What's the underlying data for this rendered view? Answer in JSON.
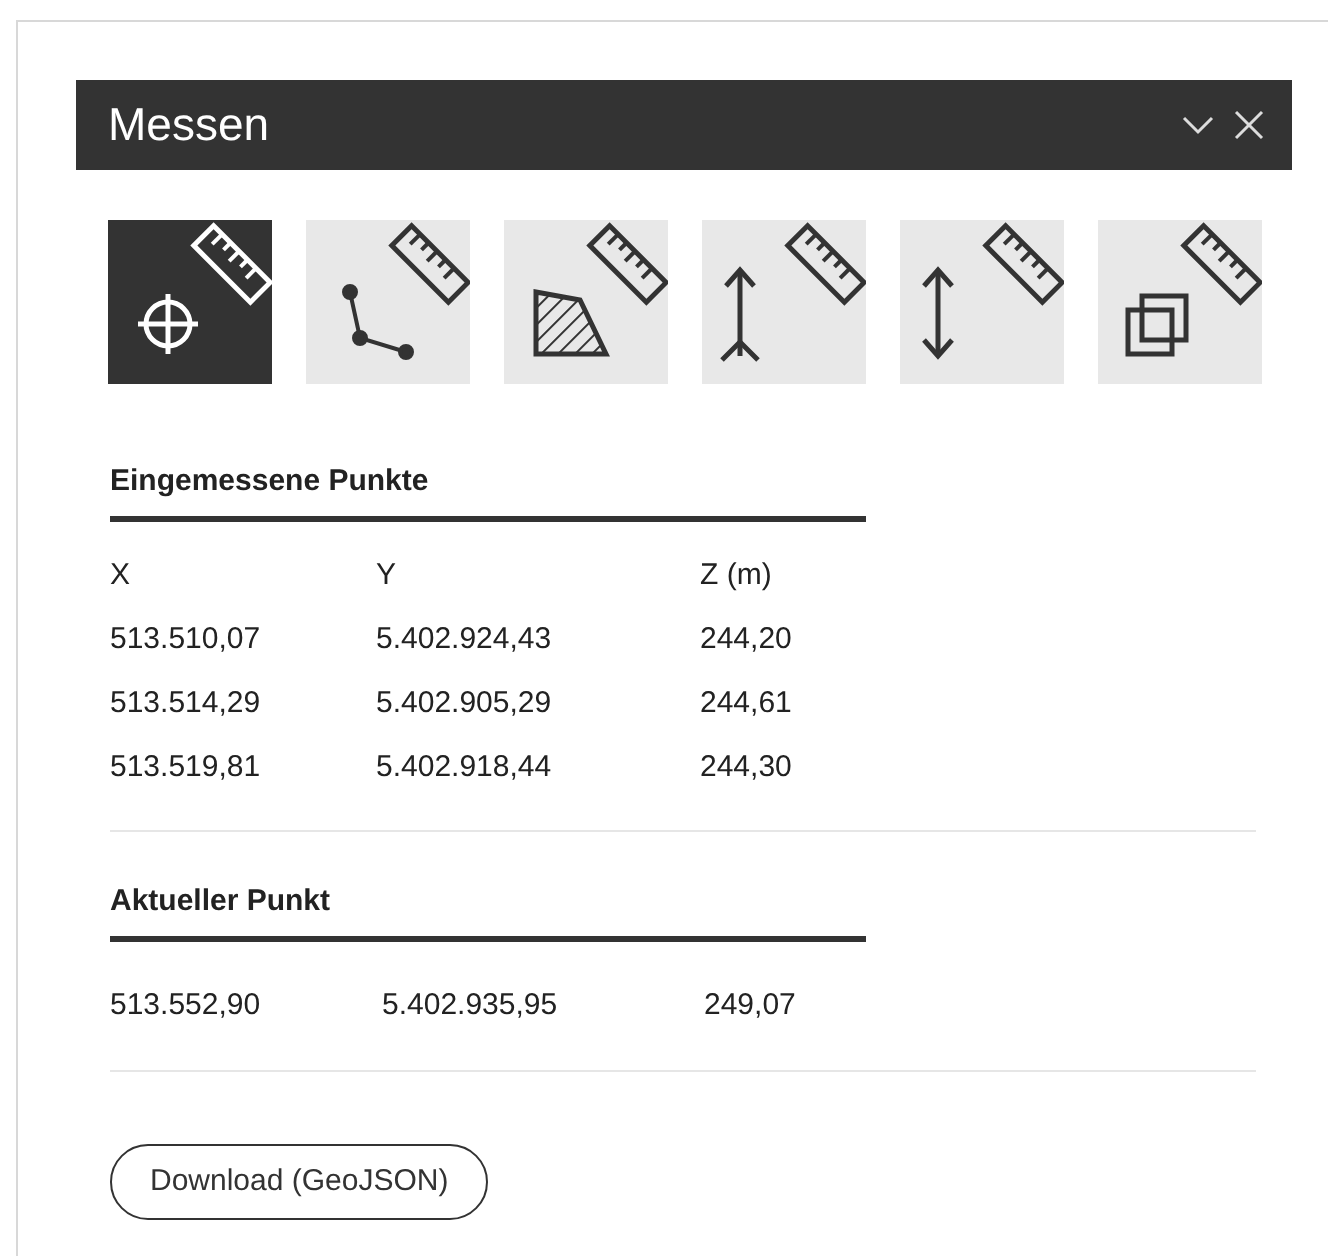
{
  "window": {
    "title": "Messen"
  },
  "tools": [
    {
      "kind": "point",
      "selected": true
    },
    {
      "kind": "distance",
      "selected": false
    },
    {
      "kind": "area",
      "selected": false
    },
    {
      "kind": "height",
      "selected": false
    },
    {
      "kind": "vertical",
      "selected": false
    },
    {
      "kind": "volume",
      "selected": false
    }
  ],
  "measured_points": {
    "title": "Eingemessene Punkte",
    "columns": [
      "X",
      "Y",
      "Z (m)"
    ],
    "rows": [
      [
        "513.510,07",
        "5.402.924,43",
        "244,20"
      ],
      [
        "513.514,29",
        "5.402.905,29",
        "244,61"
      ],
      [
        "513.519,81",
        "5.402.918,44",
        "244,30"
      ]
    ]
  },
  "current_point": {
    "title": "Aktueller Punkt",
    "values": [
      "513.552,90",
      "5.402.935,95",
      "249,07"
    ]
  },
  "download_button": "Download (GeoJSON)"
}
